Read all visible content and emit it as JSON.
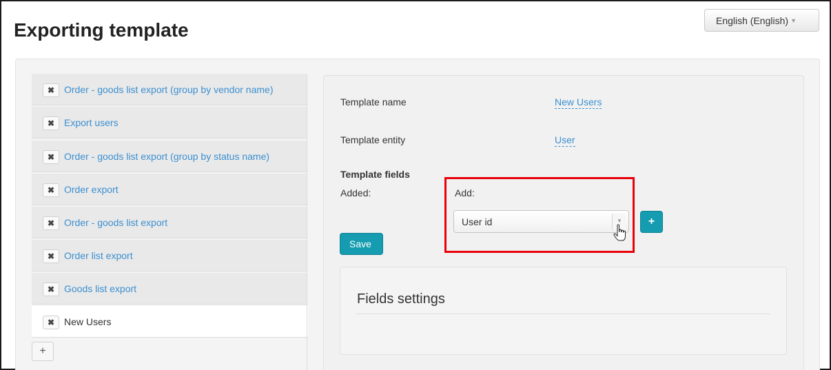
{
  "header": {
    "title": "Exporting template",
    "language_label": "English (English)"
  },
  "templates": [
    {
      "label": "Order - goods list export (group by vendor name)",
      "active": false
    },
    {
      "label": "Export users",
      "active": false
    },
    {
      "label": "Order - goods list export (group by status name)",
      "active": false
    },
    {
      "label": "Order export",
      "active": false
    },
    {
      "label": "Order - goods list export",
      "active": false
    },
    {
      "label": "Order list export",
      "active": false
    },
    {
      "label": "Goods list export",
      "active": false
    },
    {
      "label": "New Users",
      "active": true
    }
  ],
  "remove_icon": "close-icon",
  "add_template_icon": "plus-icon",
  "form": {
    "name_label": "Template name",
    "name_value": "New Users",
    "entity_label": "Template entity",
    "entity_value": "User",
    "fields_heading": "Template fields",
    "added_label": "Added:",
    "add_label": "Add:",
    "field_select_value": "User id",
    "save_label": "Save",
    "fields_settings_title": "Fields settings"
  },
  "colors": {
    "accent": "#169cb0",
    "link": "#3a8fd0",
    "highlight": "#e8000b"
  }
}
